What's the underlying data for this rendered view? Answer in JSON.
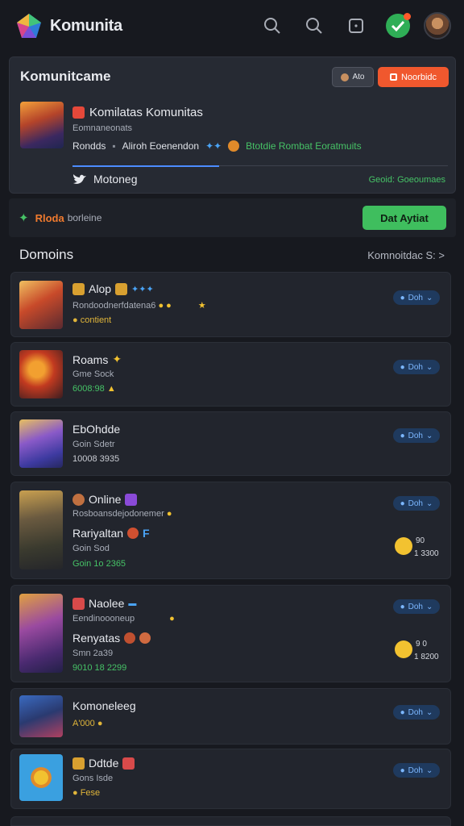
{
  "header": {
    "app_title": "Komunita",
    "icons": [
      "search-icon",
      "search-icon",
      "square-icon",
      "verified-icon",
      "avatar"
    ]
  },
  "community": {
    "title": "Komunitcame",
    "pill_small": "Ato",
    "pill_action": "Noorbidc",
    "name": "Komilatas Komunitas",
    "sub": "Eomnaneonats",
    "meta_left": "Rondds",
    "meta_mid": "Aliroh Eoenendon",
    "meta_right": "Btotdie Rombat Eoratmuits",
    "follow_label": "Motoneg",
    "right_note": "Geoid: Goeoumaes"
  },
  "mode_bar": {
    "label": "Rloda",
    "sub": "borleine",
    "button": "Dat Aytiat"
  },
  "section": {
    "title": "Domoins",
    "link": "Komnoitdac S:"
  },
  "items": [
    {
      "title": "Alop",
      "line": "Rondoodnerfdatena6",
      "accent": "contient",
      "join": "Doh"
    },
    {
      "title": "Roams",
      "line": "Gme Sock",
      "accent": "6008:98",
      "join": "Doh"
    },
    {
      "title": "EbOhdde",
      "line": "Goin Sdetr",
      "accent": "10008 3935",
      "join": "Doh"
    },
    {
      "title": "Online",
      "line": "Rosboansdejodonemer",
      "strong": "Rariyaltan",
      "line2": "Goin Sod",
      "accent": "Goin 1o 2365",
      "join": "Doh",
      "stat1": "90",
      "stat2": "1 3300"
    },
    {
      "title": "Naolee",
      "line": "Eendinoooneup",
      "strong": "Renyatas",
      "line2": "Smn 2a39",
      "accent": "9010 18 2299",
      "join": "Doh",
      "stat1": "9 0",
      "stat2": "1 8200"
    },
    {
      "title": "Komoneleeg",
      "accent": "A'000",
      "join": "Doh"
    },
    {
      "title": "Ddtde",
      "line": "Gons Isde",
      "accent": "Fese",
      "join": "Doh"
    }
  ]
}
